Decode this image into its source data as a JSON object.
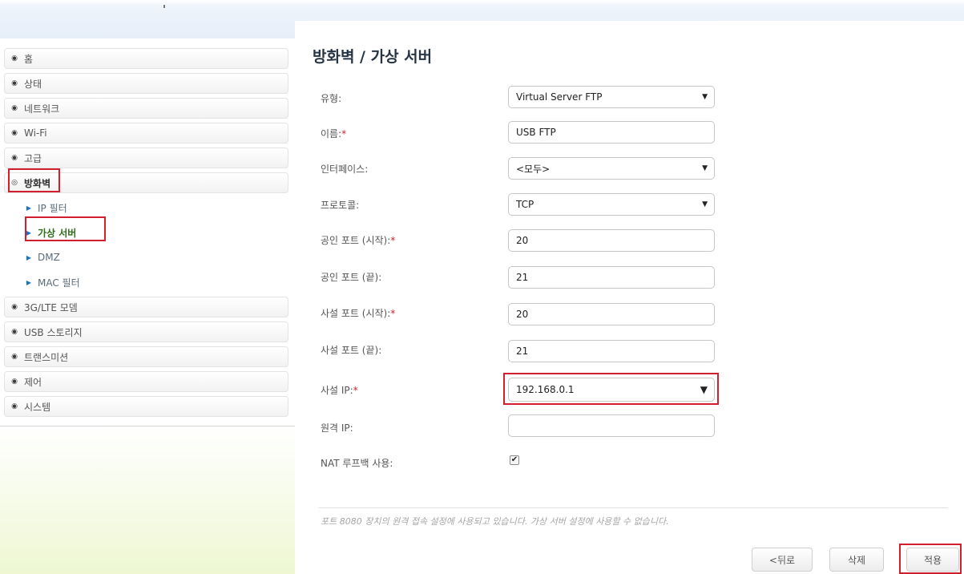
{
  "sidebar": {
    "items": [
      {
        "label": "홈",
        "icon": "circle-arrow-icon"
      },
      {
        "label": "상태",
        "icon": "circle-arrow-icon"
      },
      {
        "label": "네트워크",
        "icon": "circle-arrow-icon"
      },
      {
        "label": "Wi-Fi",
        "icon": "circle-arrow-icon"
      },
      {
        "label": "고급",
        "icon": "circle-arrow-icon"
      },
      {
        "label": "방화벽",
        "icon": "circle-arrow-down-icon"
      },
      {
        "label": "IP 필터",
        "icon": "triangle-right-icon"
      },
      {
        "label": "가상 서버",
        "icon": "triangle-right-icon"
      },
      {
        "label": "DMZ",
        "icon": "triangle-right-icon"
      },
      {
        "label": "MAC 필터",
        "icon": "triangle-right-icon"
      },
      {
        "label": "3G/LTE 모뎀",
        "icon": "circle-arrow-icon"
      },
      {
        "label": "USB 스토리지",
        "icon": "circle-arrow-icon"
      },
      {
        "label": "트랜스미션",
        "icon": "circle-arrow-icon"
      },
      {
        "label": "제어",
        "icon": "circle-arrow-icon"
      },
      {
        "label": "시스템",
        "icon": "circle-arrow-icon"
      }
    ]
  },
  "page": {
    "title": "방화벽 /  가상 서버"
  },
  "form": {
    "type": {
      "label": "유형:",
      "value": "Virtual Server FTP"
    },
    "name": {
      "label": "이름:",
      "value": "USB FTP"
    },
    "interface": {
      "label": "인터페이스:",
      "value": "<모두>"
    },
    "protocol": {
      "label": "프로토콜:",
      "value": "TCP"
    },
    "public_port_start": {
      "label": "공인 포트 (시작):",
      "value": "20"
    },
    "public_port_end": {
      "label": "공인 포트 (끝):",
      "value": "21"
    },
    "private_port_start": {
      "label": "사설 포트 (시작):",
      "value": "20"
    },
    "private_port_end": {
      "label": "사설 포트 (끝):",
      "value": "21"
    },
    "private_ip": {
      "label": "사설 IP:",
      "value": "192.168.0.1"
    },
    "remote_ip": {
      "label": "원격 IP:",
      "value": ""
    },
    "nat_loopback": {
      "label": "NAT 루프백 사용:",
      "checked": true
    }
  },
  "required_marker": "*",
  "note": "포트 8080 장치의 원격 접속 설정에 사용되고 있습니다. 가상 서버 설정에 사용할 수 없습니다.",
  "buttons": {
    "back": "<뒤로",
    "delete": "삭제",
    "apply": "적용"
  },
  "colors": {
    "highlight": "#d31f2d",
    "title": "#263445",
    "active_submenu": "#2f6e1b"
  }
}
